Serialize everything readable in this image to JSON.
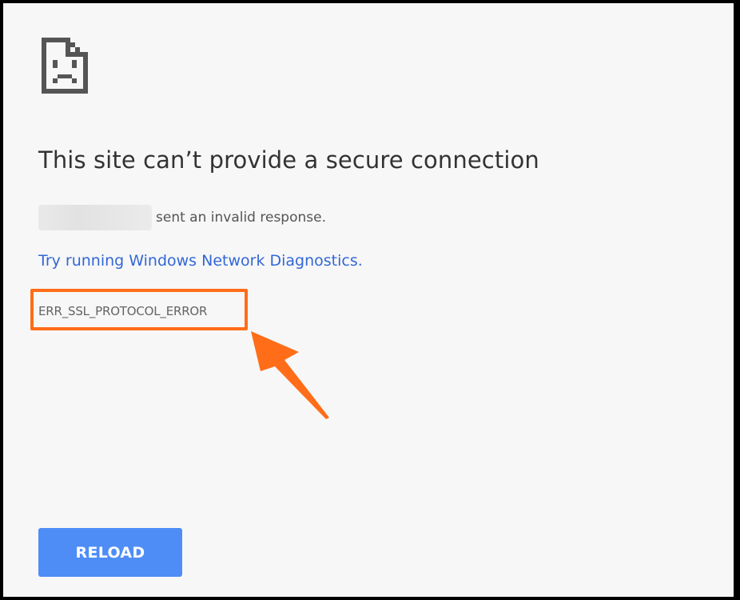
{
  "error_page": {
    "icon": "sad-page-icon",
    "title": "This site can’t provide a secure connection",
    "host_message": "sent an invalid response.",
    "diagnostics_link": "Try running Windows Network Diagnostics.",
    "error_code": "ERR_SSL_PROTOCOL_ERROR",
    "reload_label": "RELOAD"
  },
  "annotation": {
    "highlight_color": "#ff6d18",
    "arrow_color": "#ff6d18"
  },
  "colors": {
    "page_background": "#f7f7f7",
    "frame": "#000000",
    "link": "#3367d6",
    "button": "#4e8df6",
    "title": "#333333"
  }
}
